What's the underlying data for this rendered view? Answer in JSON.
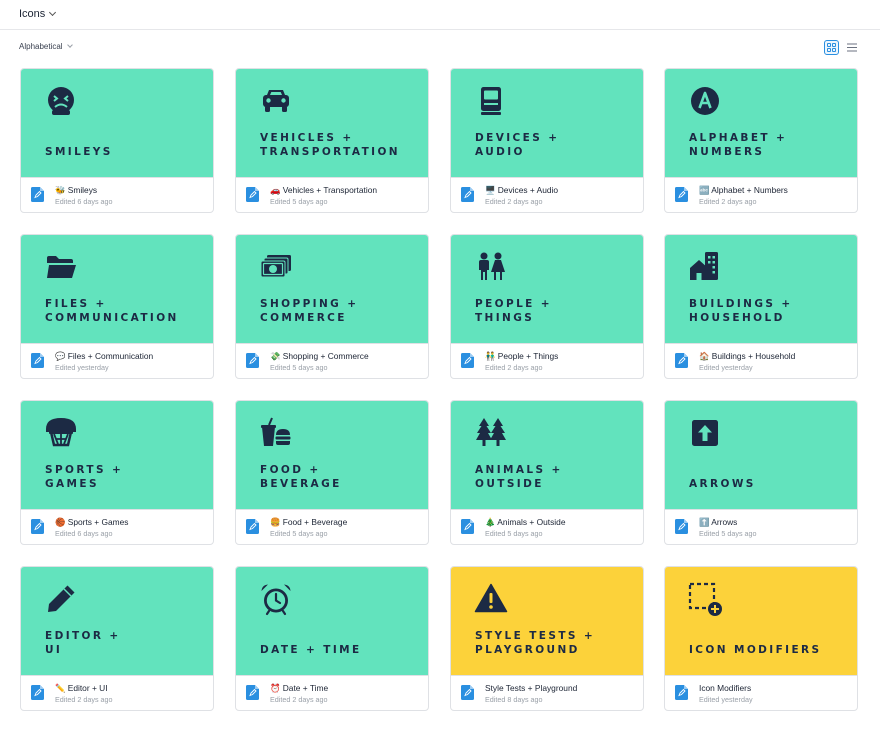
{
  "header": {
    "title": "Icons"
  },
  "toolbar": {
    "sort_label": "Alphabetical"
  },
  "colors": {
    "teal": "#62e3bd",
    "yellow": "#fcd23a",
    "icon": "#1c2a44",
    "doc": "#2a8fe0"
  },
  "cards": [
    {
      "label": "SMILEYS",
      "name": "🐝 Smileys",
      "edited": "Edited 6 days ago",
      "color": "#62e3bd",
      "icon": "smiley-icon"
    },
    {
      "label": "VEHICLES +\nTRANSPORTATION",
      "name": "🚗 Vehicles + Transportation",
      "edited": "Edited 5 days ago",
      "color": "#62e3bd",
      "icon": "car-icon"
    },
    {
      "label": "DEVICES +\nAUDIO",
      "name": "🖥️ Devices + Audio",
      "edited": "Edited 2 days ago",
      "color": "#62e3bd",
      "icon": "computer-icon"
    },
    {
      "label": "ALPHABET +\nNUMBERS",
      "name": "🔤 Alphabet + Numbers",
      "edited": "Edited 2 days ago",
      "color": "#62e3bd",
      "icon": "letter-a-icon"
    },
    {
      "label": "FILES +\nCOMMUNICATION",
      "name": "💬 Files + Communication",
      "edited": "Edited yesterday",
      "color": "#62e3bd",
      "icon": "folder-icon"
    },
    {
      "label": "SHOPPING +\nCOMMERCE",
      "name": "💸 Shopping + Commerce",
      "edited": "Edited 5 days ago",
      "color": "#62e3bd",
      "icon": "money-icon"
    },
    {
      "label": "PEOPLE +\nTHINGS",
      "name": "👬 People + Things",
      "edited": "Edited 2 days ago",
      "color": "#62e3bd",
      "icon": "people-icon"
    },
    {
      "label": "BUILDINGS +\nHOUSEHOLD",
      "name": "🏠 Buildings + Household",
      "edited": "Edited yesterday",
      "color": "#62e3bd",
      "icon": "buildings-icon"
    },
    {
      "label": "SPORTS +\nGAMES",
      "name": "🏀 Sports + Games",
      "edited": "Edited 6 days ago",
      "color": "#62e3bd",
      "icon": "basketball-hoop-icon"
    },
    {
      "label": "FOOD +\nBEVERAGE",
      "name": "🍔 Food + Beverage",
      "edited": "Edited 5 days ago",
      "color": "#62e3bd",
      "icon": "burger-drink-icon"
    },
    {
      "label": "ANIMALS +\nOUTSIDE",
      "name": "🎄 Animals + Outside",
      "edited": "Edited 5 days ago",
      "color": "#62e3bd",
      "icon": "trees-icon"
    },
    {
      "label": "ARROWS",
      "name": "⬆️ Arrows",
      "edited": "Edited 5 days ago",
      "color": "#62e3bd",
      "icon": "arrow-up-icon"
    },
    {
      "label": "EDITOR +\nUI",
      "name": "✏️ Editor + UI",
      "edited": "Edited 2 days ago",
      "color": "#62e3bd",
      "icon": "pencil-icon"
    },
    {
      "label": "DATE + TIME",
      "name": "⏰ Date + Time",
      "edited": "Edited 2 days ago",
      "color": "#62e3bd",
      "icon": "alarm-clock-icon"
    },
    {
      "label": "STYLE TESTS +\nPLAYGROUND",
      "name": "Style Tests + Playground",
      "edited": "Edited 8 days ago",
      "color": "#fcd23a",
      "icon": "warning-icon"
    },
    {
      "label": "ICON MODIFIERS",
      "name": "Icon Modifiers",
      "edited": "Edited yesterday",
      "color": "#fcd23a",
      "icon": "add-selection-icon"
    }
  ]
}
